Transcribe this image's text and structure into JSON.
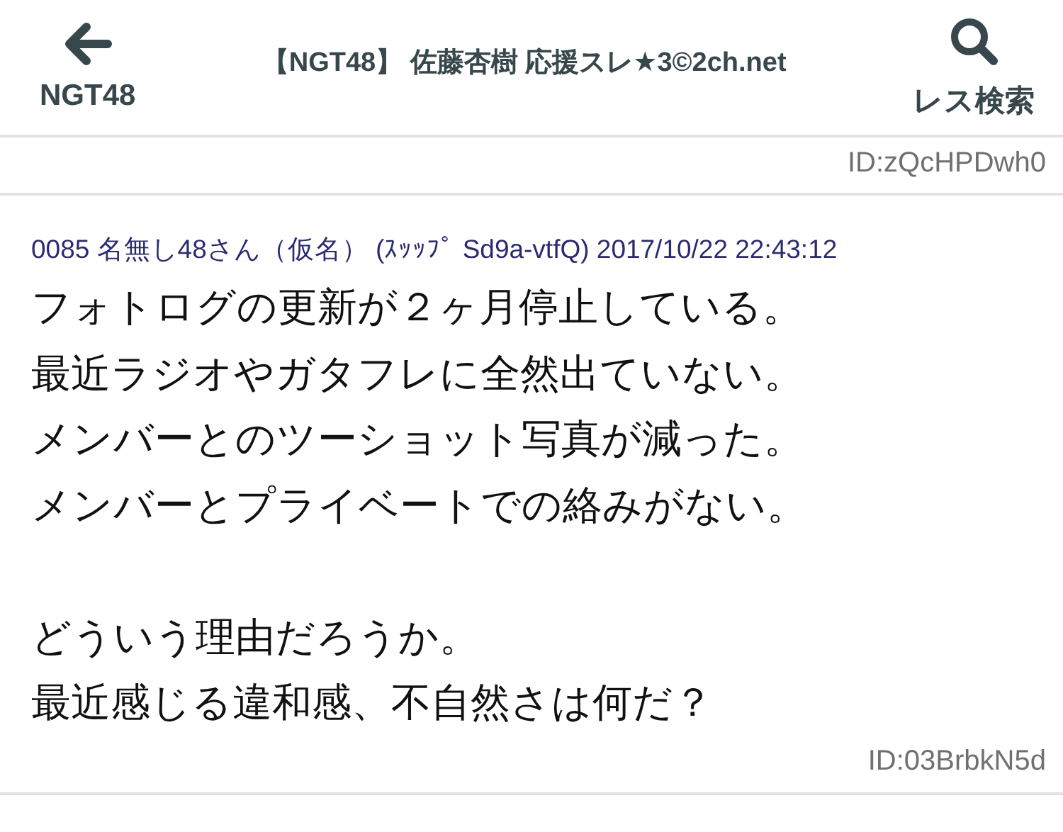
{
  "header": {
    "back_label": "NGT48",
    "title": "【NGT48】 佐藤杏樹 応援スレ★3©2ch.net",
    "search_label": "レス検索"
  },
  "posts": [
    {
      "id": "ID:zQcHPDwh0"
    },
    {
      "header": "0085 名無し48さん（仮名） (ｽｯｯﾌﾟ Sd9a-vtfQ) 2017/10/22 22:43:12",
      "paragraphs": [
        [
          "フォトログの更新が２ヶ月停止している。",
          "最近ラジオやガタフレに全然出ていない。",
          "メンバーとのツーショット写真が減った。",
          "メンバーとプライベートでの絡みがない。"
        ],
        [
          "どういう理由だろうか。",
          "最近感じる違和感、不自然さは何だ？"
        ]
      ],
      "id": "ID:03BrbkN5d"
    }
  ]
}
